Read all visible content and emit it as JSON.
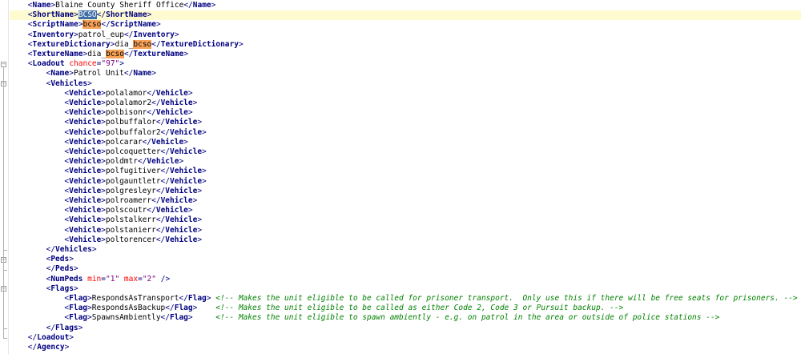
{
  "lines": [
    {
      "indent": 4,
      "parts": [
        [
          "tb",
          "<"
        ],
        [
          "tn",
          "Name"
        ],
        [
          "tb",
          ">"
        ],
        [
          "tx",
          "Blaine County Sheriff Office"
        ],
        [
          "tb",
          "</"
        ],
        [
          "tn",
          "Name"
        ],
        [
          "tb",
          ">"
        ]
      ]
    },
    {
      "indent": 4,
      "current": true,
      "parts": [
        [
          "tb",
          "<"
        ],
        [
          "tn",
          "ShortName"
        ],
        [
          "tb",
          ">"
        ],
        [
          "sel",
          "BCSO"
        ],
        [
          "tb",
          "</"
        ],
        [
          "tn",
          "ShortName"
        ],
        [
          "tb",
          ">"
        ]
      ]
    },
    {
      "indent": 4,
      "parts": [
        [
          "tb",
          "<"
        ],
        [
          "tn",
          "ScriptName"
        ],
        [
          "tb",
          ">"
        ],
        [
          "occ",
          "bcso"
        ],
        [
          "tb",
          "</"
        ],
        [
          "tn",
          "ScriptName"
        ],
        [
          "tb",
          ">"
        ]
      ]
    },
    {
      "indent": 4,
      "parts": [
        [
          "tb",
          "<"
        ],
        [
          "tn",
          "Inventory"
        ],
        [
          "tb",
          ">"
        ],
        [
          "tx",
          "patrol_eup"
        ],
        [
          "tb",
          "</"
        ],
        [
          "tn",
          "Inventory"
        ],
        [
          "tb",
          ">"
        ]
      ]
    },
    {
      "indent": 4,
      "parts": [
        [
          "tb",
          "<"
        ],
        [
          "tn",
          "TextureDictionary"
        ],
        [
          "tb",
          ">"
        ],
        [
          "tx",
          "dia_"
        ],
        [
          "occ",
          "bcso"
        ],
        [
          "tb",
          "</"
        ],
        [
          "tn",
          "TextureDictionary"
        ],
        [
          "tb",
          ">"
        ]
      ]
    },
    {
      "indent": 4,
      "parts": [
        [
          "tb",
          "<"
        ],
        [
          "tn",
          "TextureName"
        ],
        [
          "tb",
          ">"
        ],
        [
          "tx",
          "dia_"
        ],
        [
          "occ",
          "bcso"
        ],
        [
          "tb",
          "</"
        ],
        [
          "tn",
          "TextureName"
        ],
        [
          "tb",
          ">"
        ]
      ]
    },
    {
      "indent": 4,
      "fold": "open",
      "parts": [
        [
          "tb",
          "<"
        ],
        [
          "tn",
          "Loadout"
        ],
        [
          "tx",
          " "
        ],
        [
          "an",
          "chance"
        ],
        [
          "tb",
          "="
        ],
        [
          "av",
          "\"97\""
        ],
        [
          "tb",
          ">"
        ]
      ]
    },
    {
      "indent": 8,
      "parts": [
        [
          "tb",
          "<"
        ],
        [
          "tn",
          "Name"
        ],
        [
          "tb",
          ">"
        ],
        [
          "tx",
          "Patrol Unit"
        ],
        [
          "tb",
          "</"
        ],
        [
          "tn",
          "Name"
        ],
        [
          "tb",
          ">"
        ]
      ]
    },
    {
      "indent": 8,
      "fold": "open",
      "parts": [
        [
          "tb",
          "<"
        ],
        [
          "tn",
          "Vehicles"
        ],
        [
          "tb",
          ">"
        ]
      ]
    },
    {
      "indent": 12,
      "parts": [
        [
          "tb",
          "<"
        ],
        [
          "tn",
          "Vehicle"
        ],
        [
          "tb",
          ">"
        ],
        [
          "tx",
          "polalamor"
        ],
        [
          "tb",
          "</"
        ],
        [
          "tn",
          "Vehicle"
        ],
        [
          "tb",
          ">"
        ]
      ]
    },
    {
      "indent": 12,
      "parts": [
        [
          "tb",
          "<"
        ],
        [
          "tn",
          "Vehicle"
        ],
        [
          "tb",
          ">"
        ],
        [
          "tx",
          "polalamor2"
        ],
        [
          "tb",
          "</"
        ],
        [
          "tn",
          "Vehicle"
        ],
        [
          "tb",
          ">"
        ]
      ]
    },
    {
      "indent": 12,
      "parts": [
        [
          "tb",
          "<"
        ],
        [
          "tn",
          "Vehicle"
        ],
        [
          "tb",
          ">"
        ],
        [
          "tx",
          "polbisonr"
        ],
        [
          "tb",
          "</"
        ],
        [
          "tn",
          "Vehicle"
        ],
        [
          "tb",
          ">"
        ]
      ]
    },
    {
      "indent": 12,
      "parts": [
        [
          "tb",
          "<"
        ],
        [
          "tn",
          "Vehicle"
        ],
        [
          "tb",
          ">"
        ],
        [
          "tx",
          "polbuffalor"
        ],
        [
          "tb",
          "</"
        ],
        [
          "tn",
          "Vehicle"
        ],
        [
          "tb",
          ">"
        ]
      ]
    },
    {
      "indent": 12,
      "parts": [
        [
          "tb",
          "<"
        ],
        [
          "tn",
          "Vehicle"
        ],
        [
          "tb",
          ">"
        ],
        [
          "tx",
          "polbuffalor2"
        ],
        [
          "tb",
          "</"
        ],
        [
          "tn",
          "Vehicle"
        ],
        [
          "tb",
          ">"
        ]
      ]
    },
    {
      "indent": 12,
      "parts": [
        [
          "tb",
          "<"
        ],
        [
          "tn",
          "Vehicle"
        ],
        [
          "tb",
          ">"
        ],
        [
          "tx",
          "polcarar"
        ],
        [
          "tb",
          "</"
        ],
        [
          "tn",
          "Vehicle"
        ],
        [
          "tb",
          ">"
        ]
      ]
    },
    {
      "indent": 12,
      "parts": [
        [
          "tb",
          "<"
        ],
        [
          "tn",
          "Vehicle"
        ],
        [
          "tb",
          ">"
        ],
        [
          "tx",
          "polcoquetter"
        ],
        [
          "tb",
          "</"
        ],
        [
          "tn",
          "Vehicle"
        ],
        [
          "tb",
          ">"
        ]
      ]
    },
    {
      "indent": 12,
      "parts": [
        [
          "tb",
          "<"
        ],
        [
          "tn",
          "Vehicle"
        ],
        [
          "tb",
          ">"
        ],
        [
          "tx",
          "poldmtr"
        ],
        [
          "tb",
          "</"
        ],
        [
          "tn",
          "Vehicle"
        ],
        [
          "tb",
          ">"
        ]
      ]
    },
    {
      "indent": 12,
      "parts": [
        [
          "tb",
          "<"
        ],
        [
          "tn",
          "Vehicle"
        ],
        [
          "tb",
          ">"
        ],
        [
          "tx",
          "polfugitiver"
        ],
        [
          "tb",
          "</"
        ],
        [
          "tn",
          "Vehicle"
        ],
        [
          "tb",
          ">"
        ]
      ]
    },
    {
      "indent": 12,
      "parts": [
        [
          "tb",
          "<"
        ],
        [
          "tn",
          "Vehicle"
        ],
        [
          "tb",
          ">"
        ],
        [
          "tx",
          "polgauntletr"
        ],
        [
          "tb",
          "</"
        ],
        [
          "tn",
          "Vehicle"
        ],
        [
          "tb",
          ">"
        ]
      ]
    },
    {
      "indent": 12,
      "parts": [
        [
          "tb",
          "<"
        ],
        [
          "tn",
          "Vehicle"
        ],
        [
          "tb",
          ">"
        ],
        [
          "tx",
          "polgresleyr"
        ],
        [
          "tb",
          "</"
        ],
        [
          "tn",
          "Vehicle"
        ],
        [
          "tb",
          ">"
        ]
      ]
    },
    {
      "indent": 12,
      "parts": [
        [
          "tb",
          "<"
        ],
        [
          "tn",
          "Vehicle"
        ],
        [
          "tb",
          ">"
        ],
        [
          "tx",
          "polroamerr"
        ],
        [
          "tb",
          "</"
        ],
        [
          "tn",
          "Vehicle"
        ],
        [
          "tb",
          ">"
        ]
      ]
    },
    {
      "indent": 12,
      "parts": [
        [
          "tb",
          "<"
        ],
        [
          "tn",
          "Vehicle"
        ],
        [
          "tb",
          ">"
        ],
        [
          "tx",
          "polscoutr"
        ],
        [
          "tb",
          "</"
        ],
        [
          "tn",
          "Vehicle"
        ],
        [
          "tb",
          ">"
        ]
      ]
    },
    {
      "indent": 12,
      "parts": [
        [
          "tb",
          "<"
        ],
        [
          "tn",
          "Vehicle"
        ],
        [
          "tb",
          ">"
        ],
        [
          "tx",
          "polstalkerr"
        ],
        [
          "tb",
          "</"
        ],
        [
          "tn",
          "Vehicle"
        ],
        [
          "tb",
          ">"
        ]
      ]
    },
    {
      "indent": 12,
      "parts": [
        [
          "tb",
          "<"
        ],
        [
          "tn",
          "Vehicle"
        ],
        [
          "tb",
          ">"
        ],
        [
          "tx",
          "polstanierr"
        ],
        [
          "tb",
          "</"
        ],
        [
          "tn",
          "Vehicle"
        ],
        [
          "tb",
          ">"
        ]
      ]
    },
    {
      "indent": 12,
      "parts": [
        [
          "tb",
          "<"
        ],
        [
          "tn",
          "Vehicle"
        ],
        [
          "tb",
          ">"
        ],
        [
          "tx",
          "poltorencer"
        ],
        [
          "tb",
          "</"
        ],
        [
          "tn",
          "Vehicle"
        ],
        [
          "tb",
          ">"
        ]
      ]
    },
    {
      "indent": 8,
      "fold": "end",
      "parts": [
        [
          "tb",
          "</"
        ],
        [
          "tn",
          "Vehicles"
        ],
        [
          "tb",
          ">"
        ]
      ]
    },
    {
      "indent": 8,
      "fold": "open",
      "parts": [
        [
          "tb",
          "<"
        ],
        [
          "tn",
          "Peds"
        ],
        [
          "tb",
          ">"
        ]
      ]
    },
    {
      "indent": 8,
      "fold": "end",
      "parts": [
        [
          "tb",
          "</"
        ],
        [
          "tn",
          "Peds"
        ],
        [
          "tb",
          ">"
        ]
      ]
    },
    {
      "indent": 8,
      "parts": [
        [
          "tb",
          "<"
        ],
        [
          "tn",
          "NumPeds"
        ],
        [
          "tx",
          " "
        ],
        [
          "an",
          "min"
        ],
        [
          "tb",
          "="
        ],
        [
          "av",
          "\"1\""
        ],
        [
          "tx",
          " "
        ],
        [
          "an",
          "max"
        ],
        [
          "tb",
          "="
        ],
        [
          "av",
          "\"2\""
        ],
        [
          "tx",
          " "
        ],
        [
          "tb",
          "/>"
        ]
      ]
    },
    {
      "indent": 8,
      "fold": "open",
      "parts": [
        [
          "tb",
          "<"
        ],
        [
          "tn",
          "Flags"
        ],
        [
          "tb",
          ">"
        ]
      ]
    },
    {
      "indent": 12,
      "parts": [
        [
          "tb",
          "<"
        ],
        [
          "tn",
          "Flag"
        ],
        [
          "tb",
          ">"
        ],
        [
          "tx",
          "RespondsAsTransport"
        ],
        [
          "tb",
          "</"
        ],
        [
          "tn",
          "Flag"
        ],
        [
          "tb",
          ">"
        ],
        [
          "tx",
          " "
        ],
        [
          "cm",
          "<!-- Makes the unit eligible to be called for prisoner transport.  Only use this if there will be free seats for prisoners. -->"
        ]
      ]
    },
    {
      "indent": 12,
      "parts": [
        [
          "tb",
          "<"
        ],
        [
          "tn",
          "Flag"
        ],
        [
          "tb",
          ">"
        ],
        [
          "tx",
          "RespondsAsBackup"
        ],
        [
          "tb",
          "</"
        ],
        [
          "tn",
          "Flag"
        ],
        [
          "tb",
          ">"
        ],
        [
          "tx",
          "    "
        ],
        [
          "cm",
          "<!-- Makes the unit eligible to be called as either Code 2, Code 3 or Pursuit backup. -->"
        ]
      ]
    },
    {
      "indent": 12,
      "parts": [
        [
          "tb",
          "<"
        ],
        [
          "tn",
          "Flag"
        ],
        [
          "tb",
          ">"
        ],
        [
          "tx",
          "SpawnsAmbiently"
        ],
        [
          "tb",
          "</"
        ],
        [
          "tn",
          "Flag"
        ],
        [
          "tb",
          ">"
        ],
        [
          "tx",
          "     "
        ],
        [
          "cm",
          "<!-- Makes the unit eligible to spawn ambiently - e.g. on patrol in the area or outside of police stations -->"
        ]
      ]
    },
    {
      "indent": 8,
      "fold": "end",
      "parts": [
        [
          "tb",
          "</"
        ],
        [
          "tn",
          "Flags"
        ],
        [
          "tb",
          ">"
        ]
      ]
    },
    {
      "indent": 4,
      "fold": "end",
      "parts": [
        [
          "tb",
          "</"
        ],
        [
          "tn",
          "Loadout"
        ],
        [
          "tb",
          ">"
        ]
      ]
    },
    {
      "indent": 4,
      "parts": [
        [
          "tb",
          "</"
        ],
        [
          "tn",
          "Agency"
        ],
        [
          "tb",
          ">"
        ]
      ]
    }
  ]
}
